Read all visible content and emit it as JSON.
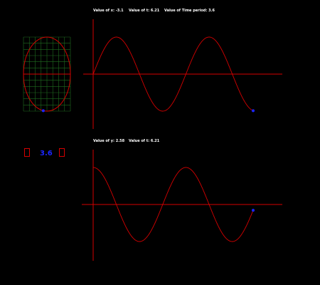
{
  "readouts": {
    "x_label": "Value of x: -3.1",
    "t_top_label": "Value of t: 6.21",
    "period_label": "Value of Time period: 3.6",
    "y_label": "Value of y: 2.58",
    "t_bottom_label": "Value of t: 6.21"
  },
  "controls": {
    "period_value": "3.6"
  },
  "sim": {
    "time": 6.21,
    "period": 3.6,
    "x_value": -3.1,
    "y_value": 2.58
  },
  "colors": {
    "background": "#000000",
    "curve": "#d40000",
    "axis": "#d40000",
    "grid": "#1f6b1f",
    "dot": "#1b26ff",
    "text": "#ffffff",
    "value": "#1b26ff"
  }
}
